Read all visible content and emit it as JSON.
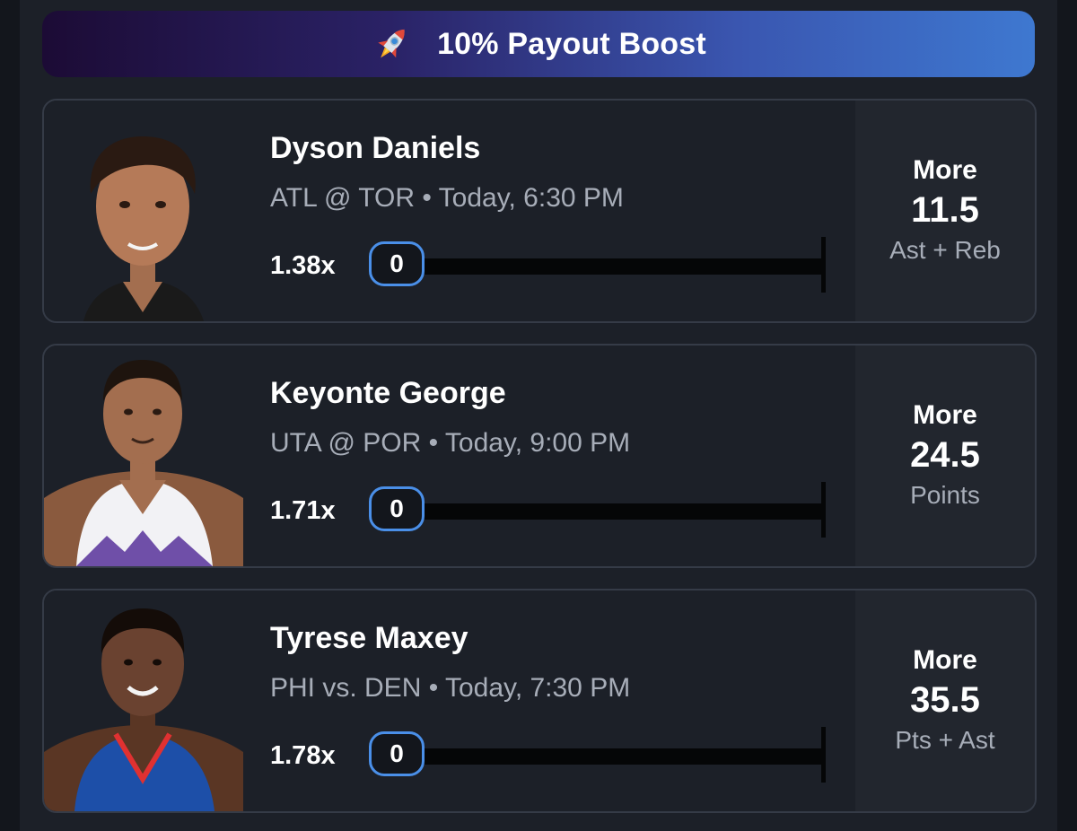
{
  "banner": {
    "icon": "rocket-icon",
    "text": "10% Payout Boost"
  },
  "cards": [
    {
      "player": "Dyson Daniels",
      "game": "ATL @ TOR • Today, 6:30 PM",
      "multiplier": "1.38x",
      "progress": "0",
      "direction": "More",
      "line": "11.5",
      "stat": "Ast + Reb",
      "jersey": "#1a1a1a",
      "trim": "#c8102e"
    },
    {
      "player": "Keyonte George",
      "game": "UTA @ POR • Today, 9:00 PM",
      "multiplier": "1.71x",
      "progress": "0",
      "direction": "More",
      "line": "24.5",
      "stat": "Points",
      "jersey": "#f2f2f5",
      "trim": "#6f4fa8"
    },
    {
      "player": "Tyrese Maxey",
      "game": "PHI vs. DEN • Today, 7:30 PM",
      "multiplier": "1.78x",
      "progress": "0",
      "direction": "More",
      "line": "35.5",
      "stat": "Pts + Ast",
      "jersey": "#1d4fa8",
      "trim": "#e03131"
    }
  ],
  "colors": {
    "accent": "#4a8fe8",
    "card_bg": "#1c2028",
    "side_bg": "#22262e",
    "muted_text": "#a7adb8"
  }
}
